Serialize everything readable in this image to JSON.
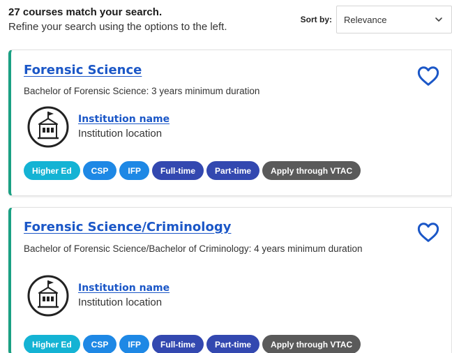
{
  "results": {
    "count_text": "27 courses match your search.",
    "hint_text": "Refine your search using the options to the left."
  },
  "sort": {
    "label": "Sort by:",
    "selected": "Relevance"
  },
  "courses": [
    {
      "title": "Forensic Science",
      "description": "Bachelor of Forensic Science: 3 years minimum duration",
      "institution_name": "Institution name",
      "institution_location": "Institution location",
      "tags": [
        "Higher Ed",
        "CSP",
        "IFP",
        "Full-time",
        "Part-time",
        "Apply through VTAC"
      ]
    },
    {
      "title": "Forensic Science/Criminology",
      "description": "Bachelor of Forensic Science/Bachelor of Criminology: 4 years minimum duration",
      "institution_name": "Institution name",
      "institution_location": "Institution location",
      "tags": [
        "Higher Ed",
        "CSP",
        "IFP",
        "Full-time",
        "Part-time",
        "Apply through VTAC"
      ]
    }
  ],
  "icons": {
    "favorite": "heart-outline-icon",
    "institution": "institution-building-icon",
    "sort_dropdown": "chevron-down-icon"
  },
  "colors": {
    "card_accent": "#1aa083",
    "link": "#1b57c7",
    "tag_higher_ed": "#14b3d4",
    "tag_csp_ifp": "#1e88e5",
    "tag_mode": "#3348b0",
    "tag_vtac": "#5a5a5a"
  }
}
